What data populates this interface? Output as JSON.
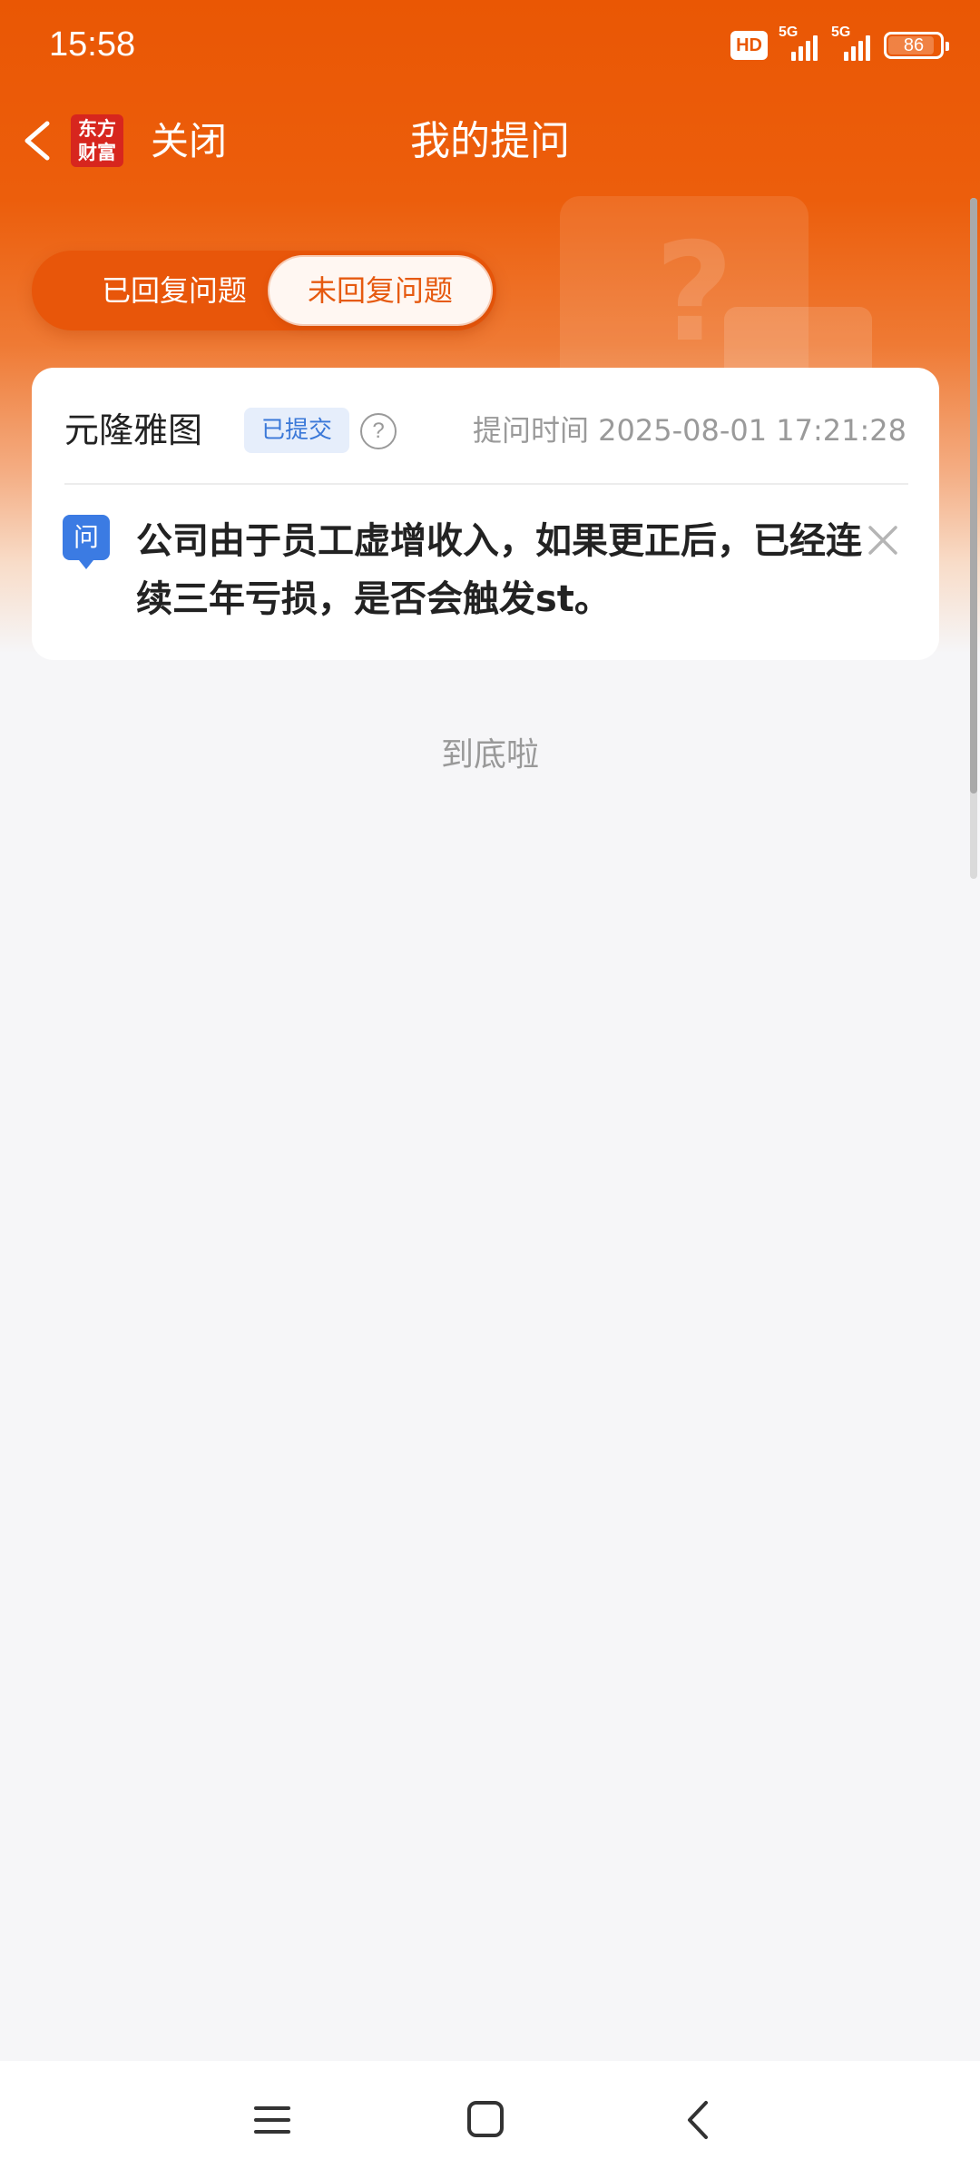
{
  "status_bar": {
    "time": "15:58",
    "hd_label": "HD",
    "network1": "5G",
    "network2": "5G",
    "battery": "86"
  },
  "nav": {
    "logo_line1": "东方",
    "logo_line2": "财富",
    "close_label": "关闭",
    "title": "我的提问"
  },
  "tabs": {
    "answered": "已回复问题",
    "unanswered": "未回复问题",
    "active": "unanswered"
  },
  "question_card": {
    "company": "元隆雅图",
    "status_badge": "已提交",
    "time_label": "提问时间 2025-08-01 17:21:28",
    "q_icon_label": "问",
    "question": "公司由于员工虚增收入，如果更正后，已经连续三年亏损，是否会触发st。"
  },
  "footer": {
    "end_hint": "到底啦"
  },
  "colors": {
    "brand_orange": "#ea5704",
    "badge_blue": "#3a78d8",
    "question_icon_blue": "#3b7be3"
  },
  "icons": [
    "back-arrow-icon",
    "app-logo",
    "help-icon",
    "question-icon",
    "close-icon",
    "menu-icon",
    "home-icon",
    "back-icon"
  ]
}
